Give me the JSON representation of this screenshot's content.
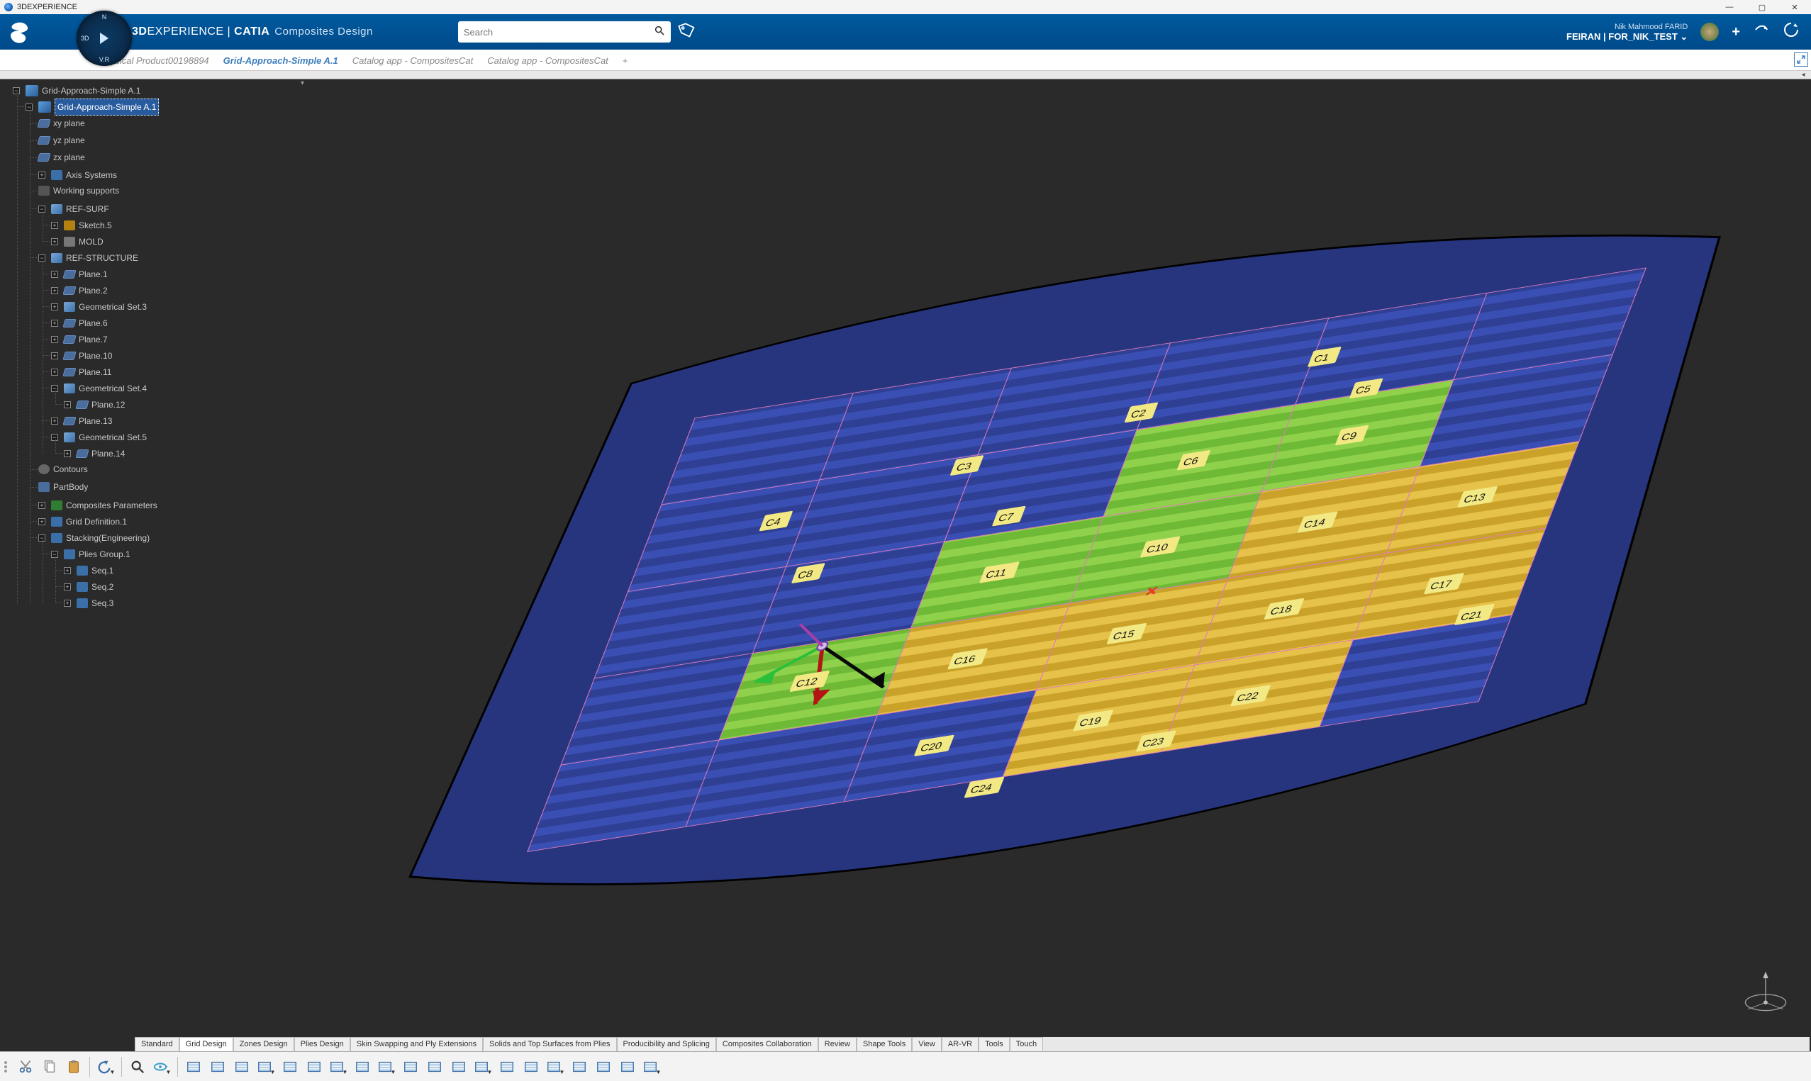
{
  "titlebar": {
    "title": "3DEXPERIENCE"
  },
  "header": {
    "brand_bold": "3D",
    "brand_rest": "EXPERIENCE",
    "brand_sep": " | ",
    "brand_app": "CATIA",
    "brand_module": "Composites Design",
    "search_placeholder": "Search",
    "user_name": "Nik Mahmood FARID",
    "user_space": "FEIRAN | FOR_NIK_TEST",
    "compass": {
      "north": "N",
      "south": "V.R",
      "west": "3D",
      "east": ""
    }
  },
  "tabs": [
    {
      "label": "Physical Product00198894",
      "active": false
    },
    {
      "label": "Grid-Approach-Simple A.1",
      "active": true
    },
    {
      "label": "Catalog app - CompositesCat",
      "active": false
    },
    {
      "label": "Catalog app - CompositesCat",
      "active": false
    }
  ],
  "tree": {
    "root": "Grid-Approach-Simple A.1",
    "selected": "Grid-Approach-Simple A.1",
    "items": {
      "xy": "xy plane",
      "yz": "yz plane",
      "zx": "zx plane",
      "axis": "Axis Systems",
      "ws": "Working supports",
      "refsurf": "REF-SURF",
      "sketch5": "Sketch.5",
      "mold": "MOLD",
      "refstruct": "REF-STRUCTURE",
      "plane1": "Plane.1",
      "plane2": "Plane.2",
      "gs3": "Geometrical Set.3",
      "plane6": "Plane.6",
      "plane7": "Plane.7",
      "plane10": "Plane.10",
      "plane11": "Plane.11",
      "gs4": "Geometrical Set.4",
      "plane12": "Plane.12",
      "plane13": "Plane.13",
      "gs5": "Geometrical Set.5",
      "plane14": "Plane.14",
      "contours": "Contours",
      "partbody": "PartBody",
      "cp": "Composites Parameters",
      "gd1": "Grid Definition.1",
      "stack": "Stacking(Engineering)",
      "pg1": "Plies Group.1",
      "seq1": "Seq.1",
      "seq2": "Seq.2",
      "seq3": "Seq.3"
    }
  },
  "cells": {
    "C1": "C1",
    "C2": "C2",
    "C3": "C3",
    "C4": "C4",
    "C5": "C5",
    "C6": "C6",
    "C7": "C7",
    "C8": "C8",
    "C9": "C9",
    "C10": "C10",
    "C11": "C11",
    "C12": "C12",
    "C13": "C13",
    "C14": "C14",
    "C15": "C15",
    "C16": "C16",
    "C17": "C17",
    "C18": "C18",
    "C19": "C19",
    "C20": "C20",
    "C21": "C21",
    "C22": "C22",
    "C23": "C23",
    "C24": "C24"
  },
  "bottom_tabs": [
    "Standard",
    "Grid Design",
    "Zones Design",
    "Plies Design",
    "Skin Swapping and Ply Extensions",
    "Solids and Top Surfaces from Plies",
    "Producibility and Splicing",
    "Composites Collaboration",
    "Review",
    "Shape Tools",
    "View",
    "AR-VR",
    "Tools",
    "Touch"
  ],
  "bottom_tabs_active": 1,
  "toolbar": [
    {
      "name": "cut-icon"
    },
    {
      "name": "copy-icon"
    },
    {
      "name": "paste-icon"
    },
    {
      "sep": true
    },
    {
      "name": "undo-icon",
      "dd": true
    },
    {
      "sep": true
    },
    {
      "name": "zoom-fit-icon"
    },
    {
      "name": "rotate-view-icon",
      "dd": true
    },
    {
      "sep": true
    },
    {
      "name": "grid-panel-icon"
    },
    {
      "name": "grid-surface-icon"
    },
    {
      "name": "grid-surface2-icon"
    },
    {
      "name": "grid-surface3-icon",
      "dd": true
    },
    {
      "name": "virtual-stacking-icon"
    },
    {
      "name": "ply-table-icon"
    },
    {
      "name": "ply-table2-icon",
      "dd": true
    },
    {
      "name": "limit-contour-icon"
    },
    {
      "name": "limit-contour2-icon",
      "dd": true
    },
    {
      "name": "rosette-icon"
    },
    {
      "name": "rosette2-icon"
    },
    {
      "name": "rosette3-icon"
    },
    {
      "name": "material-excess-icon",
      "dd": true
    },
    {
      "name": "core-sample-icon"
    },
    {
      "name": "numerical-analysis-icon"
    },
    {
      "name": "ply-exploder-icon",
      "dd": true
    },
    {
      "name": "section-icon"
    },
    {
      "name": "section2-icon"
    },
    {
      "name": "flatten-icon"
    },
    {
      "name": "export-icon",
      "dd": true
    }
  ]
}
